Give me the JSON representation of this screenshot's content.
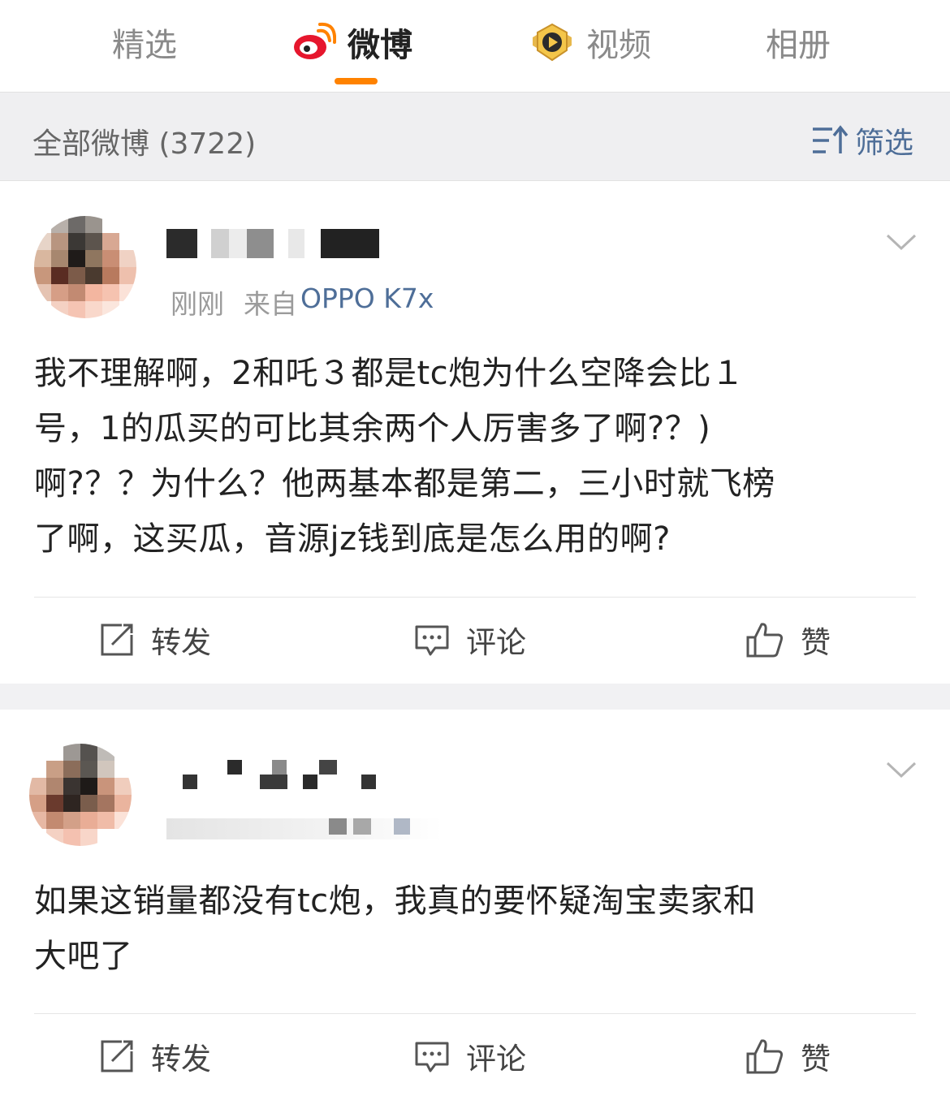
{
  "tabs": [
    {
      "label": "精选",
      "active": false
    },
    {
      "label": "微博",
      "active": true,
      "icon": "weibo-logo-icon"
    },
    {
      "label": "视频",
      "active": false,
      "icon": "video-badge-icon"
    },
    {
      "label": "相册",
      "active": false
    }
  ],
  "colors": {
    "accent": "#ff8200",
    "link": "#4e6e98",
    "background": "#efeff1"
  },
  "header": {
    "all_count": "全部微博 (3722)",
    "filter_label": "筛选",
    "filter_icon": "sort-filter-icon"
  },
  "posts": [
    {
      "time": "刚刚",
      "source_prefix": "来自",
      "source": "OPPO K7x",
      "text": "我不理解啊，2和吒３都是tc炮为什么空降会比１\n号，1的瓜买的可比其余两个人厉害多了啊?？)\n啊?？？为什么？他两基本都是第二，三小时就飞榜\n了啊，这买瓜，音源jz钱到底是怎么用的啊?",
      "actions": {
        "repost": "转发",
        "comment": "评论",
        "like": "赞"
      }
    },
    {
      "time": "刚刚",
      "source_prefix": "来自",
      "text": "如果这销量都没有tc炮，我真的要怀疑淘宝卖家和\n大吧了",
      "actions": {
        "repost": "转发",
        "comment": "评论",
        "like": "赞"
      }
    }
  ]
}
